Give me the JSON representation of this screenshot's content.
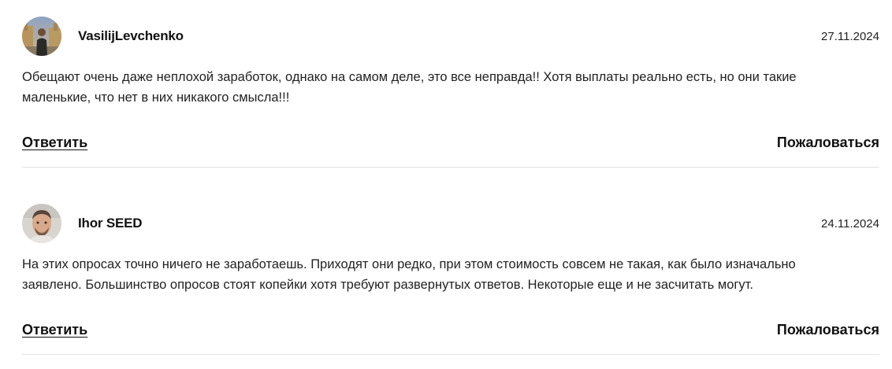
{
  "comments": [
    {
      "author": "VasilijLevchenko",
      "date": "27.11.2024",
      "text": "Обещают очень даже неплохой заработок, однако на самом деле, это все неправда!! Хотя выплаты реально есть, но они такие маленькие, что нет в них никакого смысла!!!",
      "reply_label": "Ответить",
      "report_label": "Пожаловаться",
      "avatar_icon": "user-photo-outdoor"
    },
    {
      "author": "Ihor SEED",
      "date": "24.11.2024",
      "text": "На этих опросах точно ничего не заработаешь. Приходят они редко, при этом стоимость совсем не такая, как было изначально заявлено. Большинство опросов стоят копейки хотя требуют развернутых ответов. Некоторые еще и не засчитать могут.",
      "reply_label": "Ответить",
      "report_label": "Пожаловаться",
      "avatar_icon": "user-photo-portrait"
    }
  ],
  "colors": {
    "text": "#222222",
    "divider": "#e3e3e3",
    "background": "#ffffff"
  }
}
